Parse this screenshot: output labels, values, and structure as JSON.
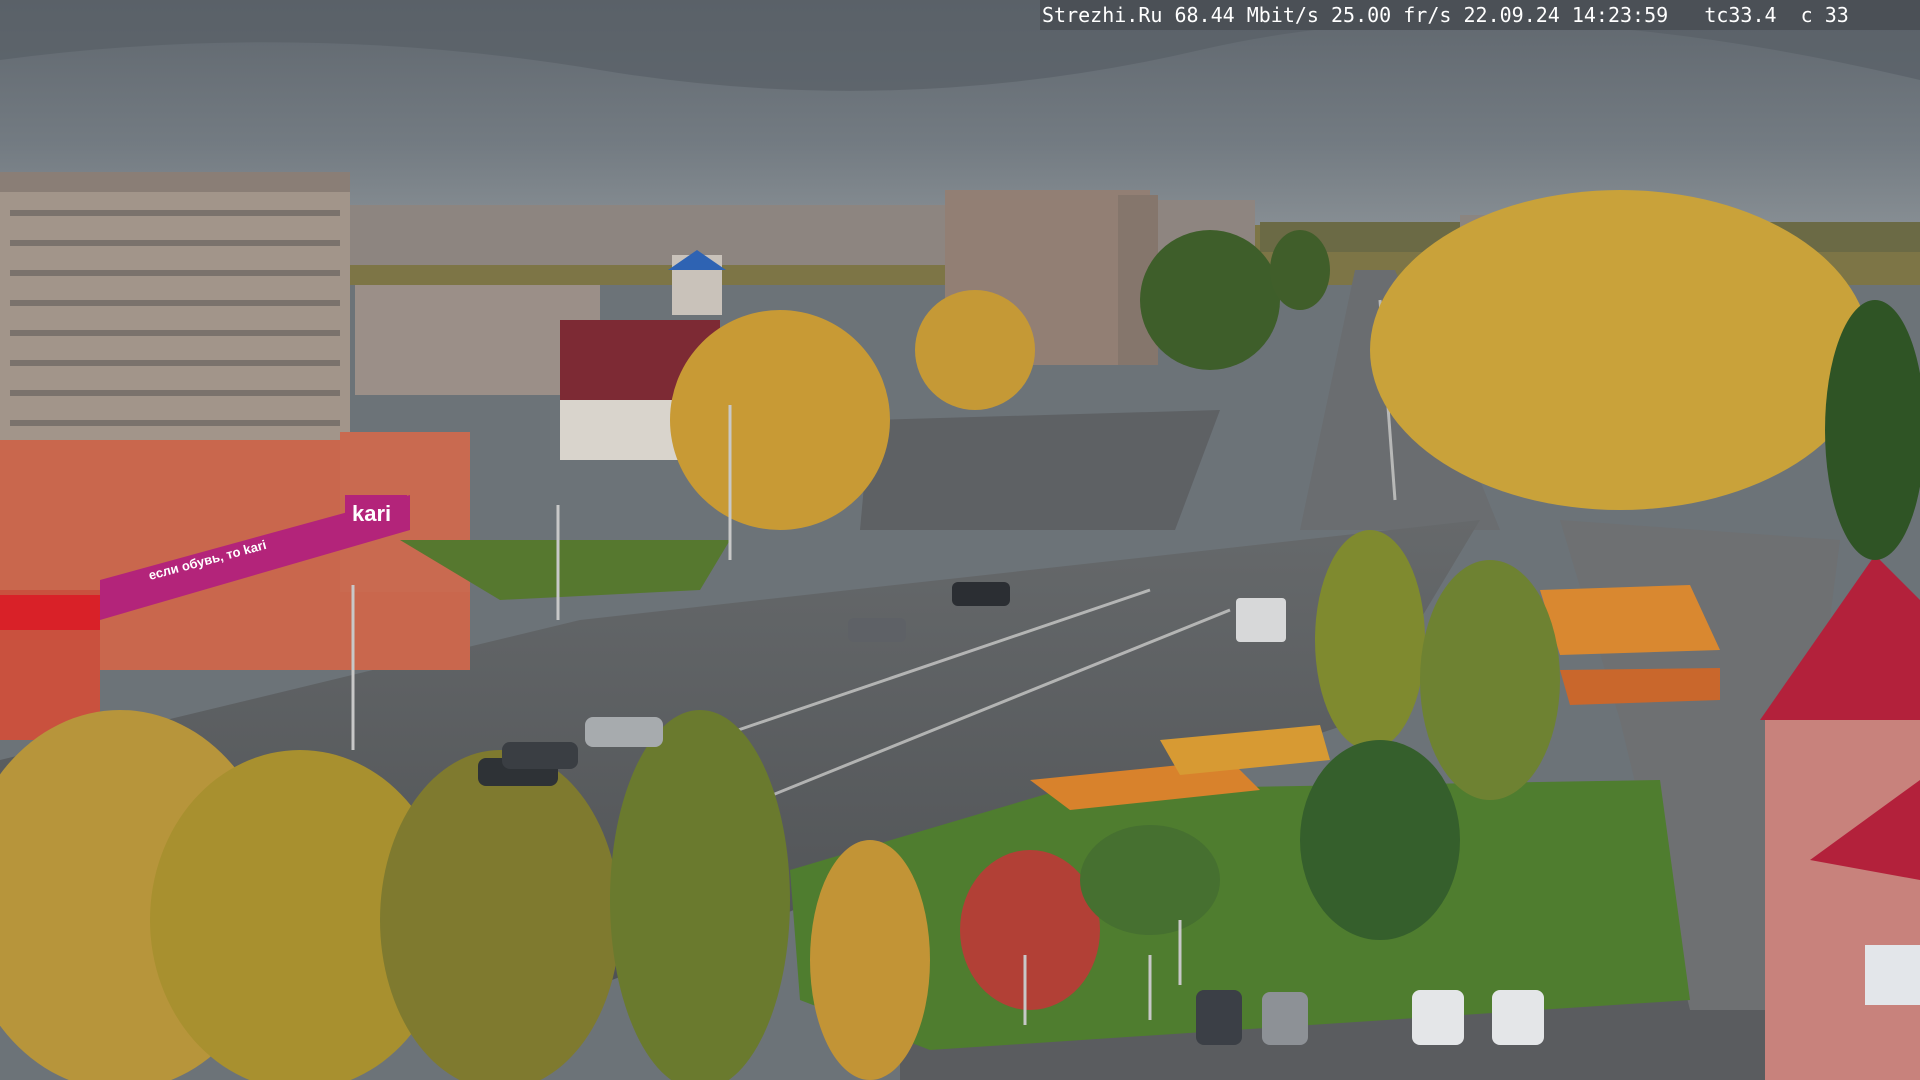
{
  "camera_overlay": {
    "site": "Strezhi.Ru",
    "bitrate": "68.44 Mbit/s",
    "framerate": "25.00 fr/s",
    "datetime": "22.09.24 14:23:59",
    "tc": "tc33.4",
    "channel": "c 33"
  },
  "scene": {
    "storefront_brand": "kari",
    "storefront_slogan": "если обувь, то kari"
  },
  "colors": {
    "sky": "#6f777e",
    "autumn_foliage": "#c9a23a",
    "road": "#5b5e61",
    "lawn": "#4f7d2f",
    "storefront": "#b3247a",
    "roof_red": "#b3213b"
  }
}
